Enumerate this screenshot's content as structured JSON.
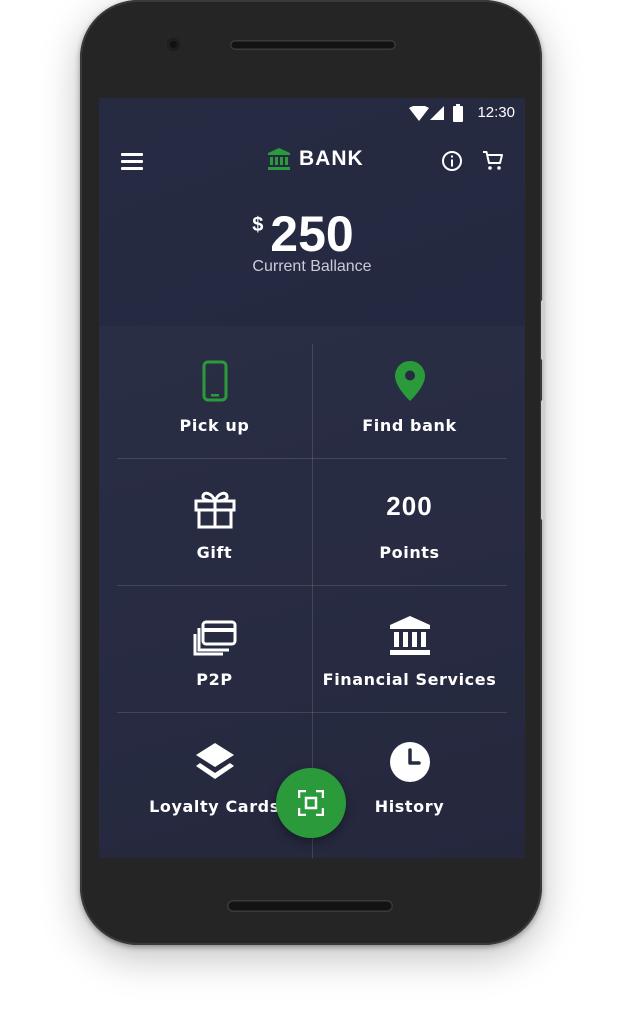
{
  "status_bar": {
    "time": "12:30"
  },
  "app_bar": {
    "brand": "BANK"
  },
  "balance": {
    "currency": "$",
    "amount": "250",
    "label": "Current Ballance"
  },
  "tiles": [
    {
      "label": "Pick up",
      "icon": "smartphone-icon"
    },
    {
      "label": "Find bank",
      "icon": "location-pin-icon"
    },
    {
      "label": "Gift",
      "icon": "gift-icon"
    },
    {
      "value": "200",
      "label": "Points"
    },
    {
      "label": "P2P",
      "icon": "cards-icon"
    },
    {
      "label": "Financial Services",
      "icon": "bank-building-icon"
    },
    {
      "label": "Loyalty Cards",
      "icon": "layers-icon"
    },
    {
      "label": "History",
      "icon": "clock-icon"
    }
  ],
  "fab": {
    "icon": "scan-icon"
  },
  "colors": {
    "accent": "#2a9a3b",
    "background": "#2a2e45",
    "text": "#ffffff"
  }
}
